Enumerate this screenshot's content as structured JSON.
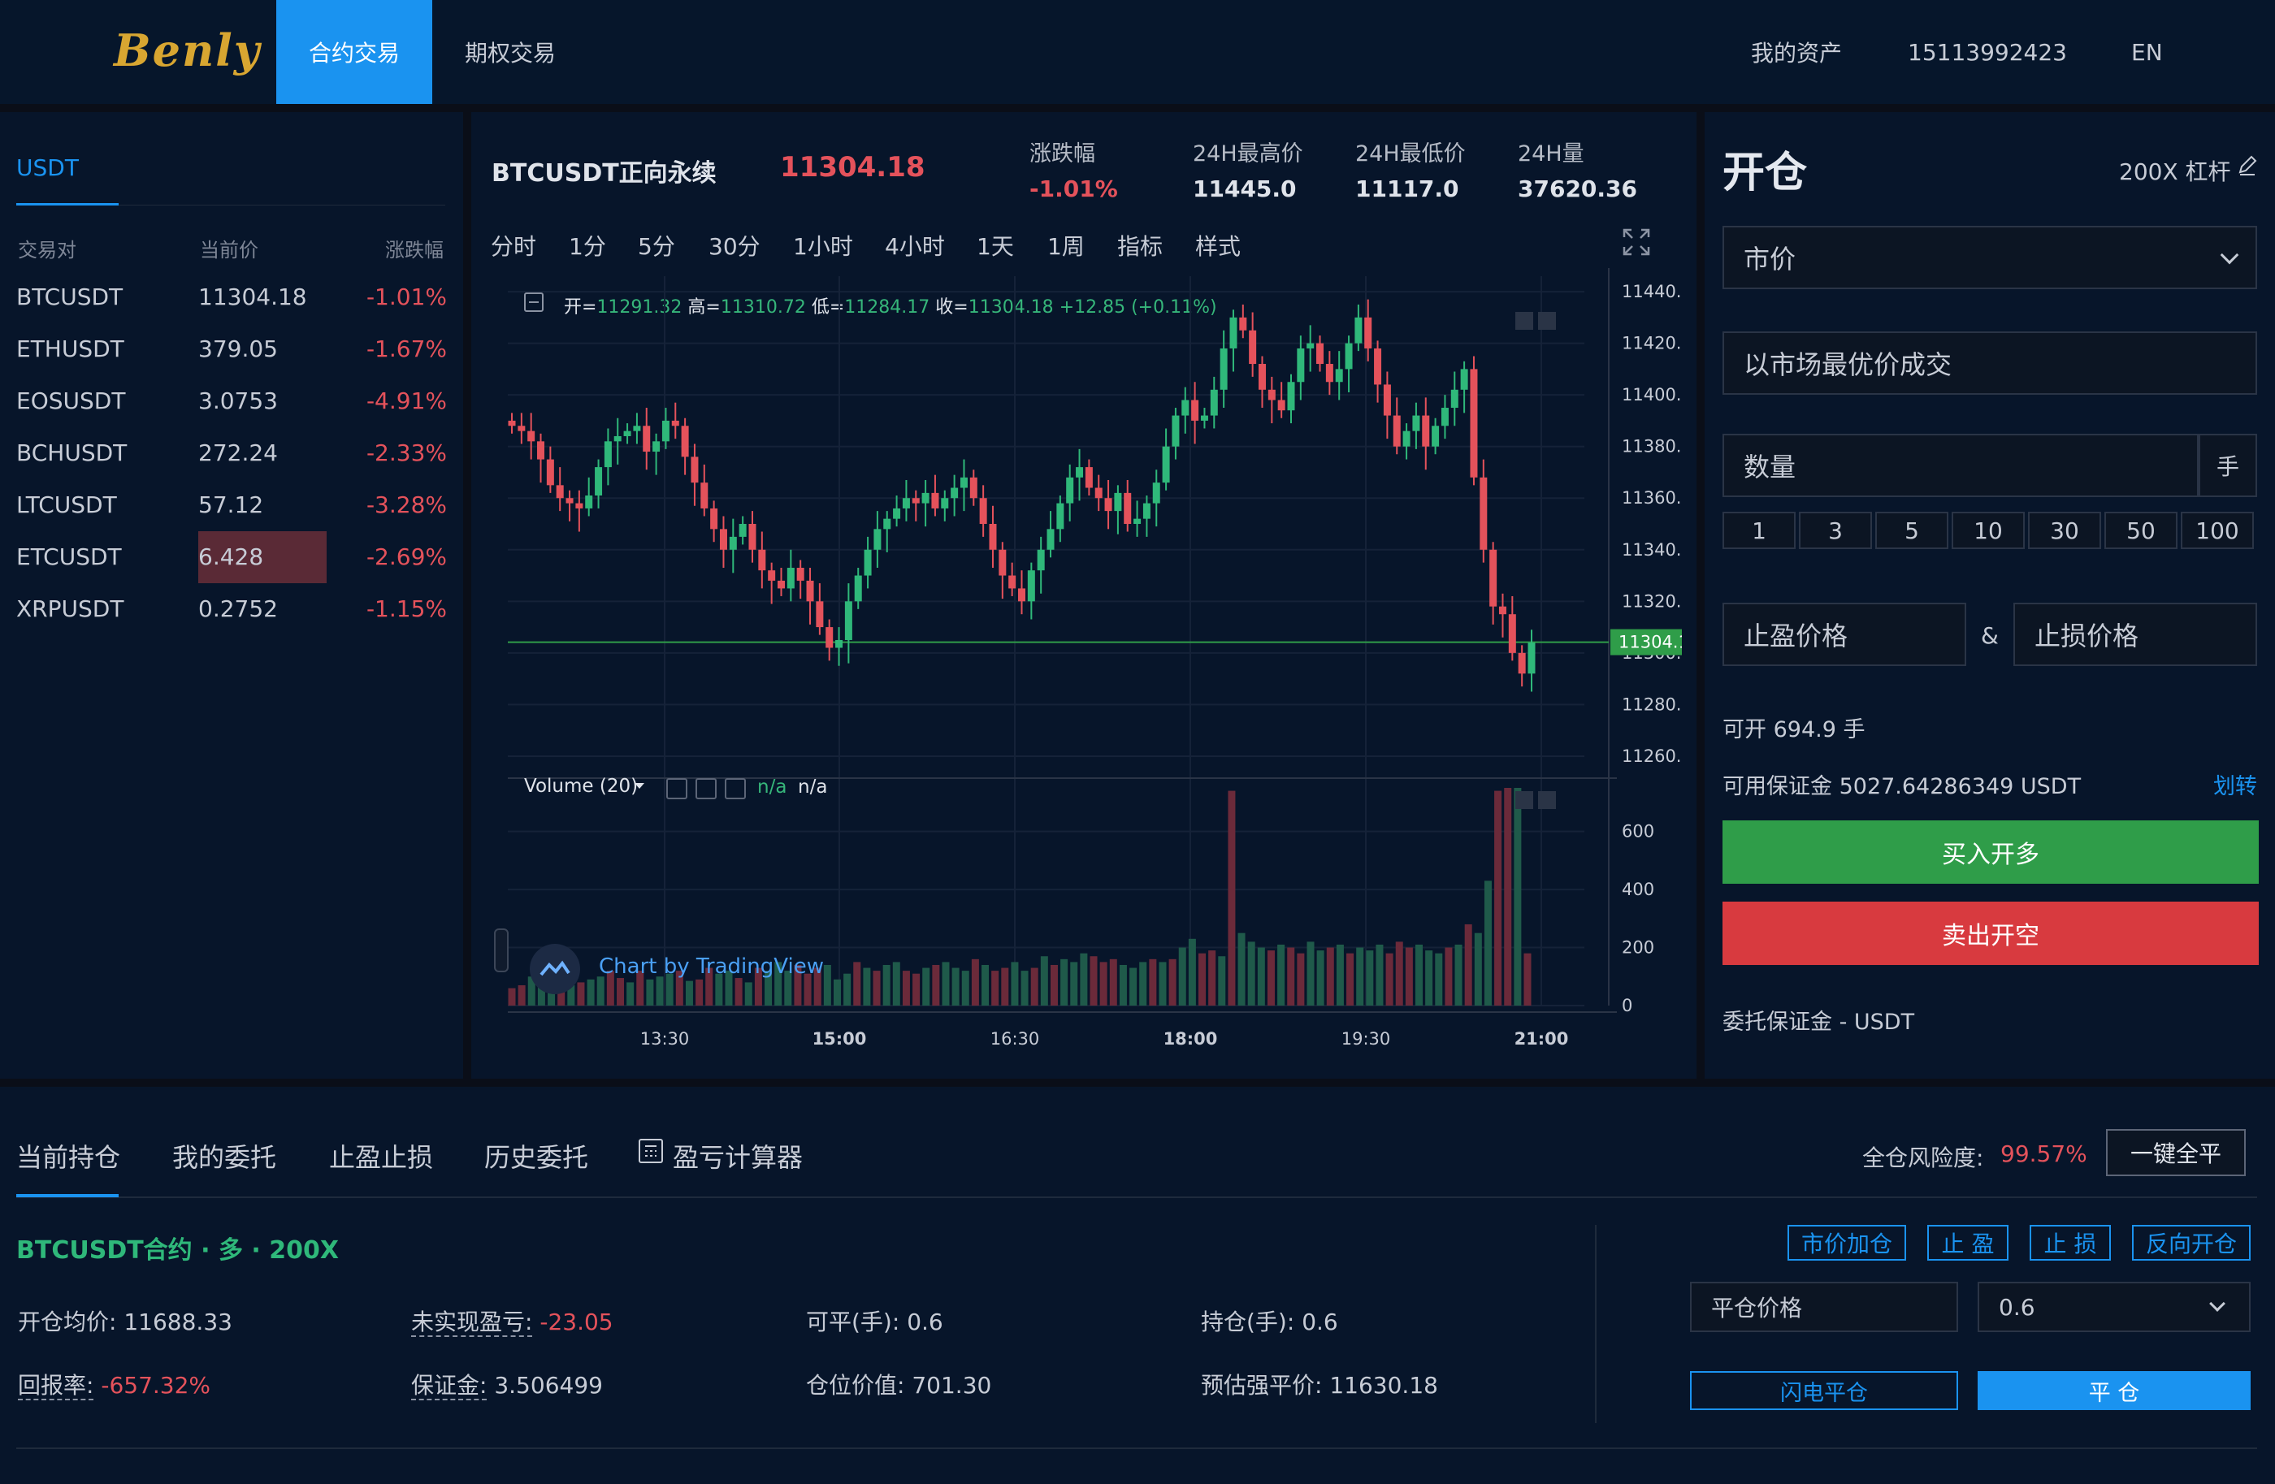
{
  "header": {
    "logo": "Benly",
    "tabs": [
      {
        "label": "合约交易",
        "active": true
      },
      {
        "label": "期权交易",
        "active": false
      }
    ],
    "assets": "我的资产",
    "phone": "15113992423",
    "lang": "EN"
  },
  "market": {
    "tab": "USDT",
    "columns": [
      "交易对",
      "当前价",
      "涨跌幅"
    ],
    "rows": [
      {
        "pair": "BTCUSDT",
        "price": "11304.18",
        "change": "-1.01%"
      },
      {
        "pair": "ETHUSDT",
        "price": "379.05",
        "change": "-1.67%"
      },
      {
        "pair": "EOSUSDT",
        "price": "3.0753",
        "change": "-4.91%"
      },
      {
        "pair": "BCHUSDT",
        "price": "272.24",
        "change": "-2.33%"
      },
      {
        "pair": "LTCUSDT",
        "price": "57.12",
        "change": "-3.28%"
      },
      {
        "pair": "ETCUSDT",
        "price": "6.428",
        "change": "-2.69%"
      },
      {
        "pair": "XRPUSDT",
        "price": "0.2752",
        "change": "-1.15%"
      }
    ]
  },
  "ticker": {
    "symbol": "BTCUSDT正向永续",
    "price": "11304.18",
    "change_label": "涨跌幅",
    "change": "-1.01%",
    "high_label": "24H最高价",
    "high": "11445.0",
    "low_label": "24H最低价",
    "low": "11117.0",
    "vol_label": "24H量",
    "vol": "37620.36"
  },
  "toolbar": {
    "intervals": [
      "分时",
      "1分",
      "5分",
      "30分",
      "1小时",
      "4小时",
      "1天",
      "1周"
    ],
    "active": "5分",
    "indicator": "指标",
    "style": "样式"
  },
  "ohlc": {
    "open_label": "开=",
    "open": "11291.32",
    "high_label": "高=",
    "high": "11310.72",
    "low_label": "低=",
    "low": "11284.17",
    "close_label": "收=",
    "close": "11304.18",
    "chg": "+12.85 (+0.11%)"
  },
  "volume_legend": {
    "label": "Volume (20)",
    "v1": "n/a",
    "v2": "n/a"
  },
  "watermark": "Chart by TradingView",
  "chart_data": {
    "type": "candlestick",
    "price_axis": [
      11440,
      11420,
      11400,
      11380,
      11360,
      11340,
      11320,
      11300,
      11280,
      11260
    ],
    "volume_axis": [
      600,
      400,
      200,
      0
    ],
    "time_axis": [
      "13:30",
      "15:00",
      "16:30",
      "18:00",
      "19:30",
      "21:00"
    ],
    "last_price": "11304.18",
    "close_series": [
      11388,
      11386,
      11382,
      11375,
      11365,
      11360,
      11358,
      11356,
      11361,
      11372,
      11382,
      11384,
      11386,
      11388,
      11378,
      11382,
      11390,
      11388,
      11376,
      11366,
      11356,
      11348,
      11340,
      11345,
      11350,
      11340,
      11332,
      11328,
      11325,
      11333,
      11328,
      11320,
      11310,
      11302,
      11305,
      11320,
      11330,
      11340,
      11348,
      11352,
      11356,
      11360,
      11358,
      11362,
      11356,
      11360,
      11364,
      11368,
      11360,
      11350,
      11340,
      11330,
      11325,
      11320,
      11332,
      11340,
      11348,
      11358,
      11368,
      11372,
      11364,
      11360,
      11355,
      11362,
      11350,
      11352,
      11358,
      11366,
      11380,
      11392,
      11398,
      11390,
      11392,
      11402,
      11418,
      11430,
      11425,
      11412,
      11402,
      11398,
      11394,
      11405,
      11418,
      11420,
      11412,
      11405,
      11410,
      11420,
      11430,
      11418,
      11404,
      11392,
      11380,
      11386,
      11392,
      11380,
      11388,
      11395,
      11402,
      11410,
      11368,
      11340,
      11318,
      11315,
      11300,
      11292,
      11304
    ],
    "volume_series": [
      60,
      70,
      100,
      80,
      90,
      110,
      70,
      80,
      90,
      100,
      120,
      95,
      80,
      120,
      90,
      100,
      110,
      120,
      85,
      90,
      130,
      110,
      120,
      95,
      80,
      130,
      120,
      150,
      120,
      140,
      110,
      130,
      140,
      90,
      110,
      150,
      130,
      120,
      140,
      150,
      120,
      110,
      130,
      140,
      150,
      130,
      120,
      160,
      140,
      120,
      130,
      150,
      120,
      130,
      170,
      140,
      160,
      150,
      180,
      170,
      150,
      160,
      140,
      130,
      150,
      160,
      150,
      160,
      200,
      230,
      180,
      190,
      170,
      740,
      250,
      220,
      200,
      190,
      210,
      200,
      180,
      220,
      190,
      200,
      210,
      180,
      200,
      190,
      210,
      180,
      220,
      200,
      210,
      190,
      180,
      200,
      210,
      280,
      250,
      430,
      740,
      750,
      750,
      180
    ]
  },
  "order": {
    "title": "开仓",
    "leverage": "200X 杠杆",
    "type": "市价",
    "price_placeholder": "以市场最优价成交",
    "qty_placeholder": "数量",
    "qty_unit": "手",
    "quick": [
      "1",
      "3",
      "5",
      "10",
      "30",
      "50",
      "100"
    ],
    "tp_placeholder": "止盈价格",
    "and": "&",
    "sl_placeholder": "止损价格",
    "avail_open": "可开 694.9 手",
    "avail_margin": "可用保证金 5027.64286349 USDT",
    "transfer": "划转",
    "buy": "买入开多",
    "sell": "卖出开空",
    "order_margin": "委托保证金 - USDT"
  },
  "bottom": {
    "tabs": [
      "当前持仓",
      "我的委托",
      "止盈止损",
      "历史委托",
      "盈亏计算器"
    ],
    "risk_label": "全仓风险度:",
    "risk": "99.57%",
    "close_all": "一键全平"
  },
  "position": {
    "title": "BTCUSDT合约 · 多 · 200X",
    "avg_label": "开仓均价:",
    "avg": "11688.33",
    "upnl_label": "未实现盈亏:",
    "upnl": "-23.05",
    "closable_label": "可平(手):",
    "closable": "0.6",
    "hold_label": "持仓(手):",
    "hold": "0.6",
    "roe_label": "回报率:",
    "roe": "-657.32%",
    "margin_label": "保证金:",
    "margin": "3.506499",
    "value_label": "仓位价值:",
    "value": "701.30",
    "liq_label": "预估强平价:",
    "liq": "11630.18",
    "actions": [
      "市价加仓",
      "止 盈",
      "止 损",
      "反向开仓"
    ],
    "close_price_placeholder": "平仓价格",
    "close_qty": "0.6",
    "flash_close": "闪电平仓",
    "close": "平 仓"
  },
  "colors": {
    "accent": "#1a93f0",
    "up": "#36b67a",
    "down": "#e4525b",
    "bg": "#07152a"
  }
}
